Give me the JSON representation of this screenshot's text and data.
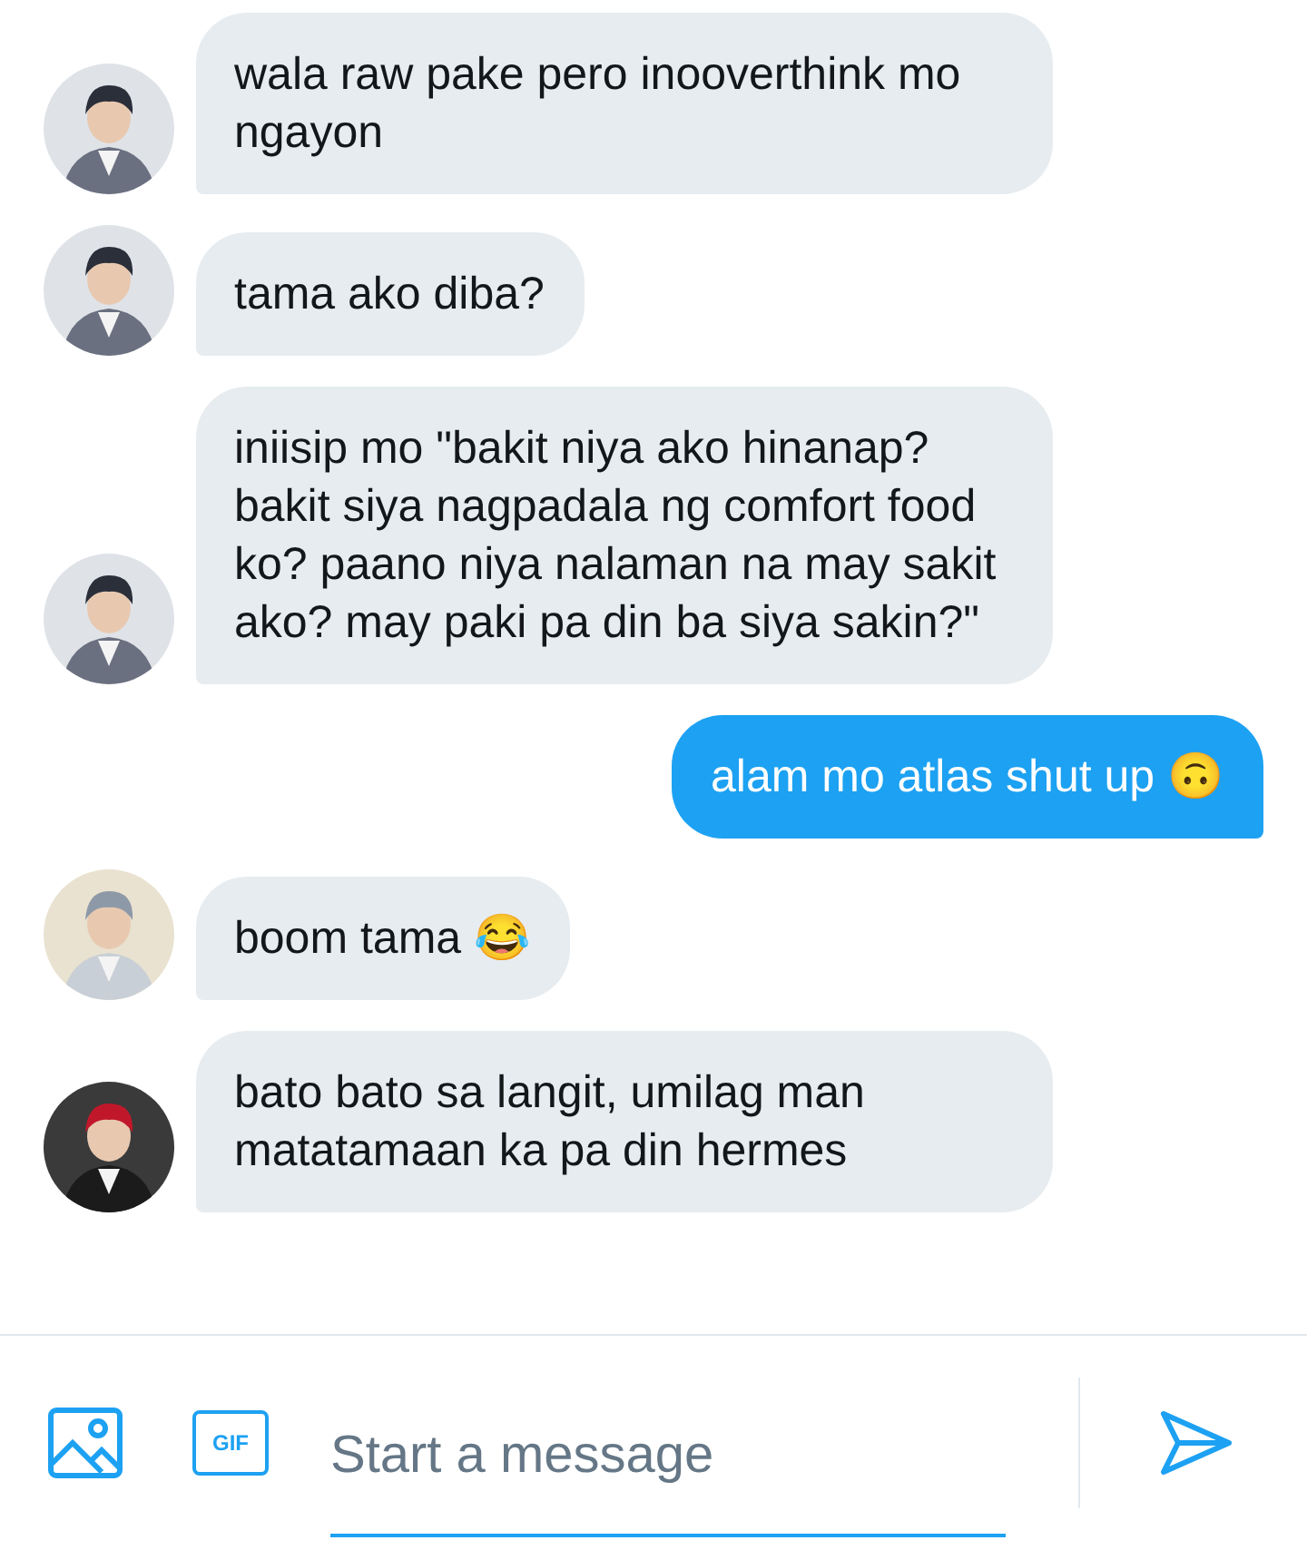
{
  "messages": [
    {
      "kind": "received",
      "text": "wala raw pake pero inooverthink mo ngayon"
    },
    {
      "kind": "received",
      "text": "tama ako diba?"
    },
    {
      "kind": "received",
      "text": "iniisip mo \"bakit niya ako hinanap? bakit siya nagpadala ng comfort food ko? paano niya nalaman na may sakit ako? may paki pa din ba siya sakin?\""
    },
    {
      "kind": "sent",
      "text": "alam mo atlas shut up 🙃"
    },
    {
      "kind": "received",
      "text": "boom tama 😂"
    },
    {
      "kind": "received",
      "text": "bato bato sa langit, umilag man matatamaan ka pa din hermes"
    }
  ],
  "composer": {
    "gif_label": "GIF",
    "placeholder": "Start a message"
  }
}
